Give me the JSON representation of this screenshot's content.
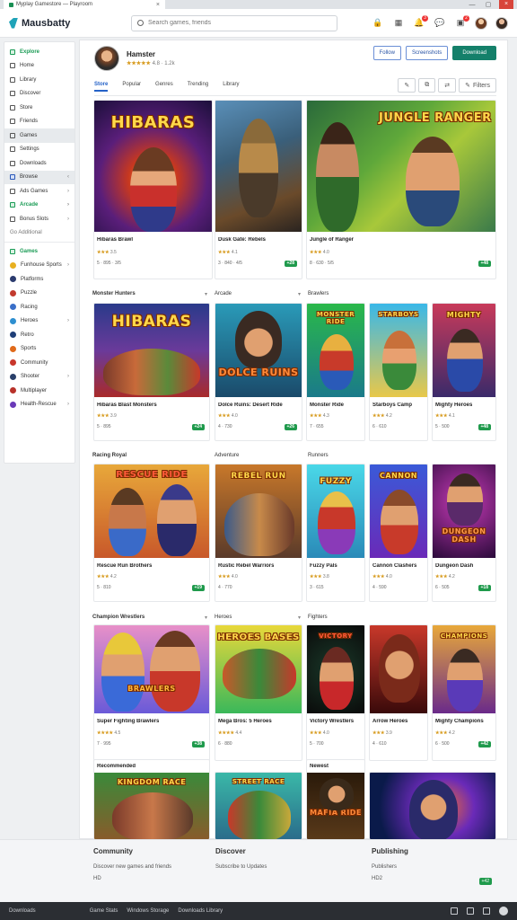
{
  "browser": {
    "tab_title": "Myplay Gamestore — Playroom",
    "close": "×"
  },
  "app": {
    "name": "Mausbatty",
    "accent": "#14806a",
    "link_color": "#2562c8"
  },
  "search": {
    "placeholder": "Search games, friends"
  },
  "sidebar": {
    "items": [
      {
        "label": "Explore",
        "icon": "compass-icon"
      },
      {
        "label": "Home",
        "icon": "home-icon"
      },
      {
        "label": "Library",
        "icon": "library-icon"
      },
      {
        "label": "Discover",
        "icon": "discover-icon"
      },
      {
        "label": "Store",
        "icon": "store-icon"
      },
      {
        "label": "Friends",
        "icon": "friends-icon"
      },
      {
        "label": "Games",
        "icon": "games-icon"
      },
      {
        "label": "Settings",
        "icon": "settings-icon"
      },
      {
        "label": "Downloads",
        "icon": "download-icon"
      },
      {
        "label": "Browse",
        "icon": "browse-icon"
      },
      {
        "label": "Ads Games",
        "icon": "ads-icon"
      },
      {
        "label": "Arcade",
        "icon": "arcade-icon"
      },
      {
        "label": "Bonus Slots",
        "icon": "slots-icon"
      },
      {
        "label": "Go Additional",
        "icon": "additional-icon"
      },
      {
        "label": "Games",
        "icon": "games-icon"
      },
      {
        "label": "Funhouse Sports",
        "icon": "sports-icon"
      },
      {
        "label": "Platforms",
        "icon": "platforms-icon"
      },
      {
        "label": "Puzzle",
        "icon": "puzzle-icon"
      },
      {
        "label": "Racing",
        "icon": "racing-icon"
      },
      {
        "label": "Heroes",
        "icon": "heroes-icon"
      },
      {
        "label": "Retro",
        "icon": "retro-icon"
      },
      {
        "label": "Sports",
        "icon": "sports-icon"
      },
      {
        "label": "Community",
        "icon": "community-icon"
      },
      {
        "label": "Shooter",
        "icon": "shooter-icon"
      },
      {
        "label": "Multiplayer",
        "icon": "multiplayer-icon"
      },
      {
        "label": "Health-Rescue",
        "icon": "health-icon"
      }
    ]
  },
  "profile": {
    "name": "Hamster",
    "rating": "★★★★★",
    "meta": "4.8 · 1.2k"
  },
  "header_buttons": {
    "follow": "Follow",
    "share": "Screenshots",
    "play": "Download"
  },
  "tabs": [
    "Store",
    "Popular",
    "Genres",
    "Trending",
    "Library"
  ],
  "tools": {
    "edit": "✎",
    "copy": "⧉",
    "share": "⇄",
    "filter_label": "Filters"
  },
  "featured": [
    {
      "title": "Hibaras Brawl",
      "art": "HIBARAS",
      "rating": "★★★",
      "score": "3.5",
      "meta": "5 · 895 · 3/5"
    },
    {
      "title": "Dusk Gate: Rebels",
      "art": "",
      "rating": "★★★",
      "score": "4.1",
      "meta": "3 · 840 · 4/5",
      "badge": "+28"
    },
    {
      "title": "Jungle of Ranger",
      "art": "JUNGLE RANGER",
      "rating": "★★★",
      "score": "4.0",
      "meta": "8 · 630 · 5/5",
      "badge": "+48"
    }
  ],
  "sections": [
    {
      "labels": [
        "Monster Hunters",
        "Arcade",
        "Brawlers"
      ],
      "games": [
        {
          "title": "Hibaras Blast Monsters",
          "art": "HIBARAS",
          "rating": "★★★",
          "score": "3.9",
          "meta": "5 · 895",
          "badge": "+24"
        },
        {
          "title": "Dolce Ruins: Desert Ride",
          "art": "DOLCE RUINS",
          "rating": "★★★",
          "score": "4.0",
          "meta": "4 · 730",
          "badge": "+26"
        },
        {
          "title": "Monster Ride",
          "art": "MONSTER RIDE",
          "rating": "★★★",
          "score": "4.3",
          "meta": "7 · 655"
        },
        {
          "title": "Starboys Camp",
          "art": "STARBOYS",
          "rating": "★★★",
          "score": "4.2",
          "meta": "6 · 610"
        },
        {
          "title": "Mighty Heroes",
          "art": "MIGHTY",
          "rating": "★★★",
          "score": "4.1",
          "meta": "5 · 500",
          "badge": "+48"
        }
      ]
    },
    {
      "labels": [
        "Racing Royal",
        "Adventure",
        "Runners"
      ],
      "games": [
        {
          "title": "Rescue Run Brothers",
          "art": "RESCUE RIDE",
          "rating": "★★★",
          "score": "4.2",
          "meta": "5 · 810",
          "badge": "+19"
        },
        {
          "title": "Rustic Rebel Warriors",
          "art": "REBEL RUN",
          "rating": "★★★",
          "score": "4.0",
          "meta": "4 · 770"
        },
        {
          "title": "Fuzzy Pals",
          "art": "FUZZY",
          "rating": "★★★",
          "score": "3.8",
          "meta": "3 · 615"
        },
        {
          "title": "Cannon Clashers",
          "art": "CANNON",
          "rating": "★★★",
          "score": "4.0",
          "meta": "4 · 590"
        },
        {
          "title": "Dungeon Dash",
          "art": "DUNGEON DASH",
          "rating": "★★★",
          "score": "4.2",
          "meta": "6 · 505",
          "badge": "+18"
        }
      ]
    },
    {
      "labels": [
        "Champion Wrestlers",
        "Heroes",
        "Fighters"
      ],
      "games": [
        {
          "title": "Super Fighting Brawlers",
          "art": "BRAWLERS",
          "rating": "★★★★",
          "score": "4.5",
          "meta": "7 · 995",
          "badge": "+38"
        },
        {
          "title": "Mega Bros: 5 Heroes",
          "art": "HEROES BASES",
          "rating": "★★★★",
          "score": "4.4",
          "meta": "6 · 880"
        },
        {
          "title": "Victory Wrestlers",
          "art": "VICTORY",
          "rating": "★★★",
          "score": "4.0",
          "meta": "5 · 700"
        },
        {
          "title": "Arrow Heroes",
          "art": "",
          "rating": "★★★",
          "score": "3.9",
          "meta": "4 · 610"
        },
        {
          "title": "Mighty Champions",
          "art": "CHAMPIONS",
          "rating": "★★★",
          "score": "4.2",
          "meta": "6 · 500",
          "badge": "+42"
        }
      ]
    }
  ],
  "last_row": [
    {
      "label": "Recommended",
      "art": "KINGDOM RACE"
    },
    {
      "label": "",
      "art": "STREET RACE"
    },
    {
      "label": "Newest",
      "art": "MAFIA RIDE"
    },
    {
      "label": "",
      "art": ""
    }
  ],
  "footer": {
    "cols": [
      {
        "title": "Community",
        "line1": "Discover new games and friends",
        "line2": "HD"
      },
      {
        "title": "Discover",
        "line1": "Subscribe to Updates",
        "line2": ""
      },
      {
        "title": "Publishing",
        "line1": "Publishers",
        "line2": "HD2"
      }
    ],
    "badge": "+42"
  },
  "statusbar": {
    "left": "Downloads",
    "mid": [
      "Game Stats",
      "Windows Storage",
      "Downloads Library"
    ]
  }
}
